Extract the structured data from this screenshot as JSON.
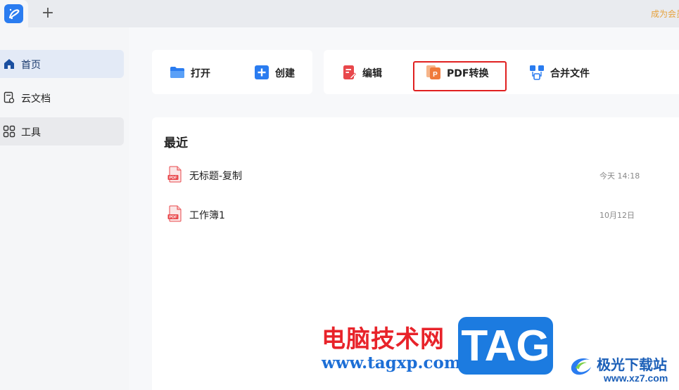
{
  "topbar": {
    "app_icon": "app-logo-icon",
    "new_tab_symbol": "+",
    "member_text": "成为会员"
  },
  "sidebar": {
    "items": [
      {
        "label": "首页",
        "icon": "home-icon",
        "active": true
      },
      {
        "label": "云文档",
        "icon": "cloud-doc-icon",
        "active": false
      },
      {
        "label": "工具",
        "icon": "tools-grid-icon",
        "active": false
      }
    ]
  },
  "quick_actions": {
    "group_a": [
      {
        "label": "打开",
        "icon": "folder-open-icon",
        "color": "#2a7cf0"
      },
      {
        "label": "创建",
        "icon": "plus-square-icon",
        "color": "#2a7cf0"
      }
    ],
    "group_b": [
      {
        "label": "编辑",
        "icon": "edit-doc-icon",
        "color": "#e8474b"
      },
      {
        "label": "PDF转换",
        "icon": "pdf-convert-icon",
        "color": "#f07a3c",
        "highlighted": true
      },
      {
        "label": "合并文件",
        "icon": "merge-files-icon",
        "color": "#2a7cf0"
      }
    ]
  },
  "recent": {
    "title": "最近",
    "files": [
      {
        "name": "无标题-复制",
        "date": "今天 14:18",
        "icon": "pdf-file-icon"
      },
      {
        "name": "工作簿1",
        "date": "10月12日",
        "icon": "pdf-file-icon"
      }
    ]
  },
  "watermark": {
    "cn_text": "电脑技术网",
    "url": "www.tagxp.com",
    "tag": "TAG",
    "site_name": "极光下载站",
    "site_url": "www.xz7.com"
  },
  "colors": {
    "accent": "#2a7cf0",
    "highlight_border": "#e02020",
    "member_text": "#e6a23c"
  }
}
